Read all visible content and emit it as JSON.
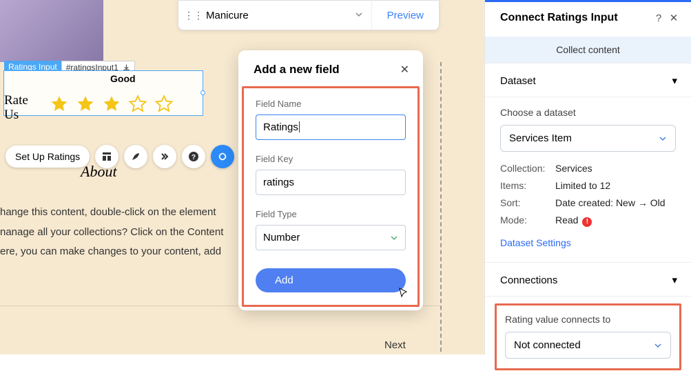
{
  "toolbar": {
    "item": "Manicure",
    "preview": "Preview"
  },
  "widget": {
    "tag_type": "Ratings Input",
    "tag_id": "#ratingsInput1",
    "good": "Good",
    "rate_line1": "Rate",
    "rate_line2": "Us"
  },
  "actions": {
    "setup": "Set Up Ratings"
  },
  "canvas": {
    "about": "About",
    "body1": "hange this content, double-click on the element",
    "body2": "nanage all your collections? Click on the Content",
    "body3": "ere, you can make changes to your content, add",
    "next": "Next"
  },
  "modal": {
    "title": "Add a new field",
    "labels": {
      "name": "Field Name",
      "key": "Field Key",
      "type": "Field Type"
    },
    "values": {
      "name": "Ratings",
      "key": "ratings",
      "type": "Number"
    },
    "add": "Add"
  },
  "panel": {
    "title": "Connect Ratings Input",
    "collect": "Collect content",
    "dataset": {
      "header": "Dataset",
      "choose": "Choose a dataset",
      "selected": "Services Item",
      "rows": {
        "collection_k": "Collection:",
        "collection_v": "Services",
        "items_k": "Items:",
        "items_v": "Limited to 12",
        "sort_k": "Sort:",
        "sort_v": "Date created: New → Old",
        "mode_k": "Mode:",
        "mode_v": "Read"
      },
      "settings": "Dataset Settings"
    },
    "connections": {
      "header": "Connections",
      "label": "Rating value connects to",
      "value": "Not connected"
    }
  }
}
